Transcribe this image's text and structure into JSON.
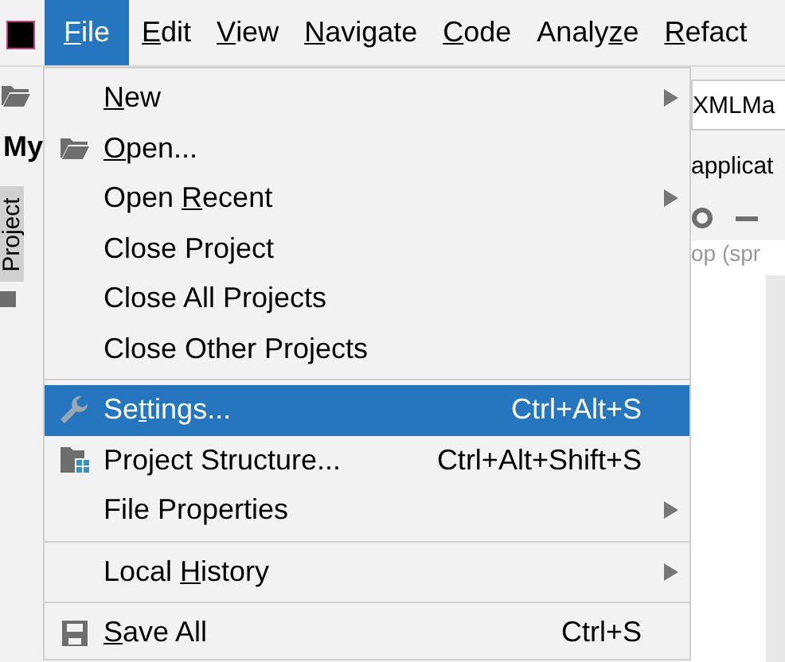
{
  "menu_bar": [
    {
      "label": {
        "key": "F",
        "after": "ile"
      },
      "selected": true
    },
    {
      "label": {
        "key": "E",
        "after": "dit"
      },
      "selected": false
    },
    {
      "label": {
        "key": "V",
        "after": "iew"
      },
      "selected": false
    },
    {
      "label": {
        "key": "N",
        "after": "avigate"
      },
      "selected": false
    },
    {
      "label": {
        "key": "C",
        "after": "ode"
      },
      "selected": false
    },
    {
      "label": {
        "before": "Analy",
        "key": "z",
        "after": "e"
      },
      "selected": false
    },
    {
      "label": {
        "key": "R",
        "after": "efact"
      },
      "selected": false
    }
  ],
  "project_pane": {
    "title": "My",
    "tool_tab": "Project"
  },
  "editor_side": {
    "field": "XMLMa",
    "breadcrumb": "applicat",
    "path": "op (spr"
  },
  "file_menu": [
    {
      "kind": "item",
      "label": {
        "key": "N",
        "after": "ew"
      },
      "submenu": true,
      "selected": false
    },
    {
      "kind": "folder_item",
      "label": {
        "key": "O",
        "after": "pen..."
      },
      "selected": false
    },
    {
      "kind": "item",
      "label": {
        "before": "Open ",
        "key": "R",
        "after": "ecent"
      },
      "submenu": true,
      "selected": false
    },
    {
      "kind": "item",
      "label": {
        "before": "Close Project"
      },
      "selected": false
    },
    {
      "kind": "item",
      "label": {
        "before": "Close All Projects"
      },
      "selected": false
    },
    {
      "kind": "item",
      "label": {
        "before": "Close Other Projects"
      },
      "selected": false
    },
    {
      "kind": "separator"
    },
    {
      "kind": "wrench_item",
      "label": {
        "before": "Se",
        "key": "t",
        "after": "tings..."
      },
      "shortcut": "Ctrl+Alt+S",
      "selected": true
    },
    {
      "kind": "structure_item",
      "label": {
        "before": "Project Structure..."
      },
      "shortcut": "Ctrl+Alt+Shift+S",
      "selected": false
    },
    {
      "kind": "item",
      "label": {
        "before": "File Properties"
      },
      "submenu": true,
      "selected": false
    },
    {
      "kind": "separator"
    },
    {
      "kind": "item",
      "label": {
        "before": "Local ",
        "key": "H",
        "after": "istory"
      },
      "submenu": true,
      "selected": false
    },
    {
      "kind": "separator"
    },
    {
      "kind": "save_item",
      "label": {
        "key": "S",
        "after": "ave All"
      },
      "shortcut": "Ctrl+S",
      "selected": false
    }
  ]
}
